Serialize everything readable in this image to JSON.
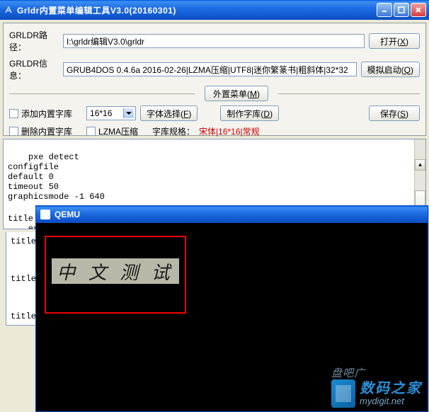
{
  "window": {
    "title": "Grldr内置菜单编辑工具V3.0(20160301)"
  },
  "form": {
    "path_label": "GRLDR路径：",
    "path_value": "I:\\grldr编辑V3.0\\grldr",
    "info_label": "GRLDR信息：",
    "info_value": "GRUB4DOS 0.4.6a 2016-02-26|LZMA压缩|UTF8|迷你繁篆书|粗斜体|32*32",
    "open_btn": "打开",
    "open_key": "X",
    "sim_btn": "模拟启动",
    "sim_key": "Q",
    "ext_menu_btn": "外置菜单",
    "ext_menu_key": "M",
    "add_font_cb": "添加内置字库",
    "del_font_cb": "删除内置字库",
    "lzma_cb": "LZMA压缩",
    "size_combo": "16*16",
    "font_sel_btn": "字体选择",
    "font_sel_key": "F",
    "make_font_btn": "制作字库",
    "make_font_key": "D",
    "save_btn": "保存",
    "save_key": "S",
    "font_spec_label": "字库规格：",
    "font_spec_value": "宋体|16*16|常规"
  },
  "editor_text": "pxe detect\nconfigfile\ndefault 0\ntimeout 50\ngraphicsmode -1 640\n\ntitle 中文测试\n    errorcheck off",
  "leftover_text": "title\n\ntitle\n\ntitle",
  "qemu": {
    "title": "QEMU",
    "sample_text": "中 文 测 试"
  },
  "watermark": {
    "cn": "数码之家",
    "en": "mydigit.net",
    "sub": "盘吧广网"
  }
}
